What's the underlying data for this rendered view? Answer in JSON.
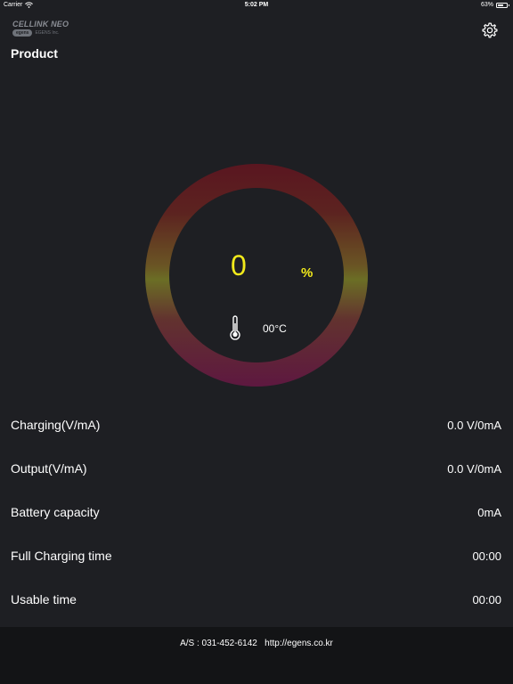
{
  "status_bar": {
    "carrier": "Carrier",
    "time": "5:02 PM",
    "battery_percent": "63%",
    "battery_level": 0.63
  },
  "header": {
    "logo_brand": "CELLINK NEO",
    "logo_badge": "egens",
    "logo_company": "EGENS Inc.",
    "title": "Product"
  },
  "gauge": {
    "charge_value": "0",
    "charge_unit": "%",
    "temperature": "00°C",
    "value_color": "#f2ea1b"
  },
  "rows": [
    {
      "label": "Charging(V/mA)",
      "value": "0.0 V/0mA"
    },
    {
      "label": "Output(V/mA)",
      "value": "0.0 V/0mA"
    },
    {
      "label": "Battery capacity",
      "value": "0mA"
    },
    {
      "label": "Full Charging time",
      "value": "00:00"
    },
    {
      "label": "Usable time",
      "value": "00:00"
    }
  ],
  "footer": {
    "as_phone": "A/S : 031-452-6142",
    "website": "http://egens.co.kr"
  },
  "icons": {
    "settings": "gear-icon",
    "temperature": "thermometer-icon",
    "wifi": "wifi-icon",
    "battery": "battery-icon"
  },
  "colors": {
    "background": "#1e1f23",
    "footer_background": "#131416",
    "accent": "#f2ea1b"
  }
}
